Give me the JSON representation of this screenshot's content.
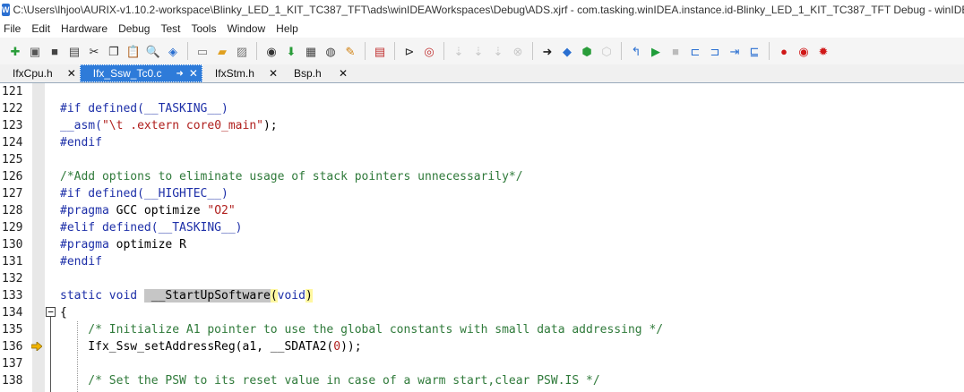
{
  "window": {
    "title": "C:\\Users\\lhjoo\\AURIX-v1.10.2-workspace\\Blinky_LED_1_KIT_TC387_TFT\\ads\\winIDEAWorkspaces\\Debug\\ADS.xjrf - com.tasking.winIDEA.instance.id-Blinky_LED_1_KIT_TC387_TFT Debug - winIDEA",
    "app_icon": "W"
  },
  "menu": [
    "File",
    "Edit",
    "Hardware",
    "Debug",
    "Test",
    "Tools",
    "Window",
    "Help"
  ],
  "toolbar": {
    "icons": [
      "new-file-icon",
      "open-icon",
      "save-icon",
      "save-all-icon",
      "cut-icon",
      "copy-icon",
      "paste-icon",
      "find-icon",
      "zoom-icon",
      "sep",
      "window-icon",
      "folder-icon",
      "image-icon",
      "sep",
      "watch-icon",
      "download-icon",
      "memory-icon",
      "disassembly-icon",
      "edit-icon",
      "sep",
      "registers-icon",
      "sep",
      "play-circle-icon",
      "inspect-icon",
      "sep",
      "download-disabled-icon",
      "download-disabled-icon",
      "download-disabled-icon",
      "delete-disabled-icon",
      "sep",
      "step-into-icon",
      "run-to-icon",
      "run-active-icon",
      "run-disabled-icon",
      "sep",
      "return-icon",
      "run-icon",
      "stop-icon",
      "step-over-icon",
      "step-into-line-icon",
      "step-out-icon",
      "step-list-icon",
      "sep",
      "breakpoint-icon",
      "breakpoint-data-icon",
      "breakpoint-settings-icon"
    ]
  },
  "tabs": [
    {
      "label": "IfxCpu.h",
      "active": false
    },
    {
      "label": "Ifx_Ssw_Tc0.c",
      "active": true
    },
    {
      "label": "IfxStm.h",
      "active": false
    },
    {
      "label": "Bsp.h",
      "active": false
    }
  ],
  "colors": {
    "tab_active": "#2e7bd9",
    "keyword": "#1d2fa8",
    "comment": "#2f7a3a",
    "string": "#b0201e",
    "selection": "#c6c6c6",
    "paren_match": "#fff7a0"
  },
  "code": {
    "lines": [
      {
        "n": "121",
        "segs": []
      },
      {
        "n": "122",
        "segs": [
          {
            "t": "#if defined(__TASKING__)",
            "c": "pp"
          }
        ]
      },
      {
        "n": "123",
        "segs": [
          {
            "t": "__asm(",
            "c": "kw"
          },
          {
            "t": "\"\\t .extern core0_main\"",
            "c": "st"
          },
          {
            "t": ");",
            "c": ""
          }
        ]
      },
      {
        "n": "124",
        "segs": [
          {
            "t": "#endif",
            "c": "pp"
          }
        ]
      },
      {
        "n": "125",
        "segs": []
      },
      {
        "n": "126",
        "segs": [
          {
            "t": "/*Add options to eliminate usage of stack pointers unnecessarily*/",
            "c": "cm"
          }
        ]
      },
      {
        "n": "127",
        "segs": [
          {
            "t": "#if defined(__HIGHTEC__)",
            "c": "pp"
          }
        ]
      },
      {
        "n": "128",
        "segs": [
          {
            "t": "#pragma",
            "c": "pp"
          },
          {
            "t": " GCC optimize ",
            "c": ""
          },
          {
            "t": "\"O2\"",
            "c": "st"
          }
        ]
      },
      {
        "n": "129",
        "segs": [
          {
            "t": "#elif defined(__TASKING__)",
            "c": "pp"
          }
        ]
      },
      {
        "n": "130",
        "segs": [
          {
            "t": "#pragma",
            "c": "pp"
          },
          {
            "t": " optimize R",
            "c": ""
          }
        ]
      },
      {
        "n": "131",
        "segs": [
          {
            "t": "#endif",
            "c": "pp"
          }
        ]
      },
      {
        "n": "132",
        "segs": []
      },
      {
        "n": "133",
        "segs": [
          {
            "t": "static void ",
            "c": "kw"
          },
          {
            "t": " __StartUpSoftware",
            "c": "sel"
          },
          {
            "t": "(",
            "c": "par"
          },
          {
            "t": "void",
            "c": "kw"
          },
          {
            "t": ")",
            "c": "par"
          }
        ]
      },
      {
        "n": "134",
        "segs": [
          {
            "t": "{",
            "c": ""
          }
        ],
        "fold": "−"
      },
      {
        "n": "135",
        "segs": [
          {
            "t": "    /* Initialize A1 pointer to use the global constants with small data addressing */",
            "c": "cm"
          }
        ]
      },
      {
        "n": "136",
        "segs": [
          {
            "t": "    Ifx_Ssw_setAddressReg(a1, __SDATA2(",
            "c": ""
          },
          {
            "t": "0",
            "c": "st"
          },
          {
            "t": "));",
            "c": ""
          }
        ],
        "marker": true
      },
      {
        "n": "137",
        "segs": []
      },
      {
        "n": "138",
        "segs": [
          {
            "t": "    /* Set the PSW to its reset value in case of a warm start,clear PSW.IS */",
            "c": "cm"
          }
        ]
      }
    ]
  }
}
